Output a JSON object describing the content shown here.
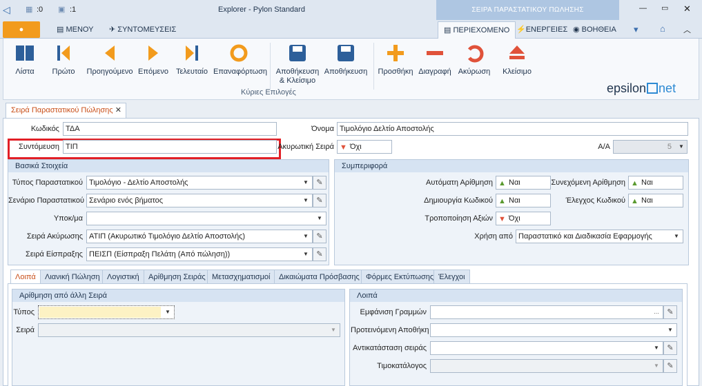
{
  "window": {
    "title": "Explorer - Pylon Standard",
    "context_title": "ΣΕΙΡΑ ΠΑΡΑΣΤΑΤΙΚΟΥ ΠΩΛΗΣΗΣ",
    "count_a": ":0",
    "count_b": ":1"
  },
  "menu": {
    "menu": "ΜΕΝΟΥ",
    "shortcuts": "ΣΥΝΤΟΜΕΥΣΕΙΣ",
    "content": "ΠΕΡΙΕΧΟΜΕΝΟ",
    "actions": "ΕΝΕΡΓΕΙΕΣ",
    "help": "ΒΟΗΘΕΙΑ"
  },
  "ribbon": {
    "list": "Λίστα",
    "first": "Πρώτο",
    "prev": "Προηγούμενο",
    "next": "Επόμενο",
    "last": "Τελευταίο",
    "restore": "Επαναφόρτωση",
    "save_close_1": "Αποθήκευση",
    "save_close_2": "& Κλείσιμο",
    "save": "Αποθήκευση",
    "add": "Προσθήκη",
    "delete": "Διαγραφή",
    "cancel": "Ακύρωση",
    "close": "Κλείσιμο",
    "group": "Κύριες Επιλογές",
    "brand_a": "epsilon",
    "brand_b": "net"
  },
  "doc_tab": "Σειρά Παραστατικού Πώλησης",
  "form": {
    "code_label": "Κωδικός",
    "code": "ΤΔΑ",
    "short_label": "Συντόμευση",
    "short": "ΤΙΠ",
    "name_label": "Όνομα",
    "name": "Τιμολόγιο Δελτίο Αποστολής",
    "cancel_series_label": "Ακυρωτική Σειρά",
    "cancel_series": "Όχι",
    "aa_label": "Α/Α",
    "aa": "5"
  },
  "basic": {
    "title": "Βασικά Στοιχεία",
    "type_label": "Τύπος Παραστατικού",
    "type": "Τιμολόγιο - Δελτίο Αποστολής",
    "scenario_label": "Σενάριο Παραστατικού",
    "scenario": "Σενάριο ενός βήματος",
    "branch_label": "Υποκ/μα",
    "branch": "",
    "cancel_label": "Σειρά Ακύρωσης",
    "cancel": "ΑΤΙΠ (Ακυρωτικό Τιμολόγιο Δελτίο Αποστολής)",
    "receipt_label": "Σειρά Είσπραξης",
    "receipt": "ΠΕΙΣΠ (Είσπραξη Πελάτη (Από πώληση))"
  },
  "behav": {
    "title": "Συμπεριφορά",
    "auto_label": "Αυτόματη Αρίθμηση",
    "auto": "Ναι",
    "cont_label": "Συνεχόμενη Αρίθμηση",
    "cont": "Ναι",
    "create_label": "Δημιουργία Κωδικού",
    "create": "Ναι",
    "check_label": "Έλεγχος Κωδικού",
    "check": "Ναι",
    "modify_label": "Τροποποίηση Αξιών",
    "modify": "Όχι",
    "use_label": "Χρήση από",
    "use": "Παραστατικό και Διαδικασία Εφαρμογής"
  },
  "tabs": [
    "Λοιπά",
    "Λιανική Πώληση",
    "Λογιστική",
    "Αρίθμηση Σειράς",
    "Μετασχηματισμοί",
    "Δικαιώματα Πρόσβασης",
    "Φόρμες Εκτύπωσης",
    "Έλεγχοι"
  ],
  "numbering": {
    "title": "Αρίθμηση από άλλη Σειρά",
    "type_label": "Τύπος",
    "series_label": "Σειρά"
  },
  "other": {
    "title": "Λοιπά",
    "lines_label": "Εμφάνιση Γραμμών",
    "warehouse_label": "Προτεινόμενη Αποθήκη",
    "replace_label": "Αντικατάσταση σειράς",
    "pricelist_label": "Τιμοκατάλογος"
  }
}
